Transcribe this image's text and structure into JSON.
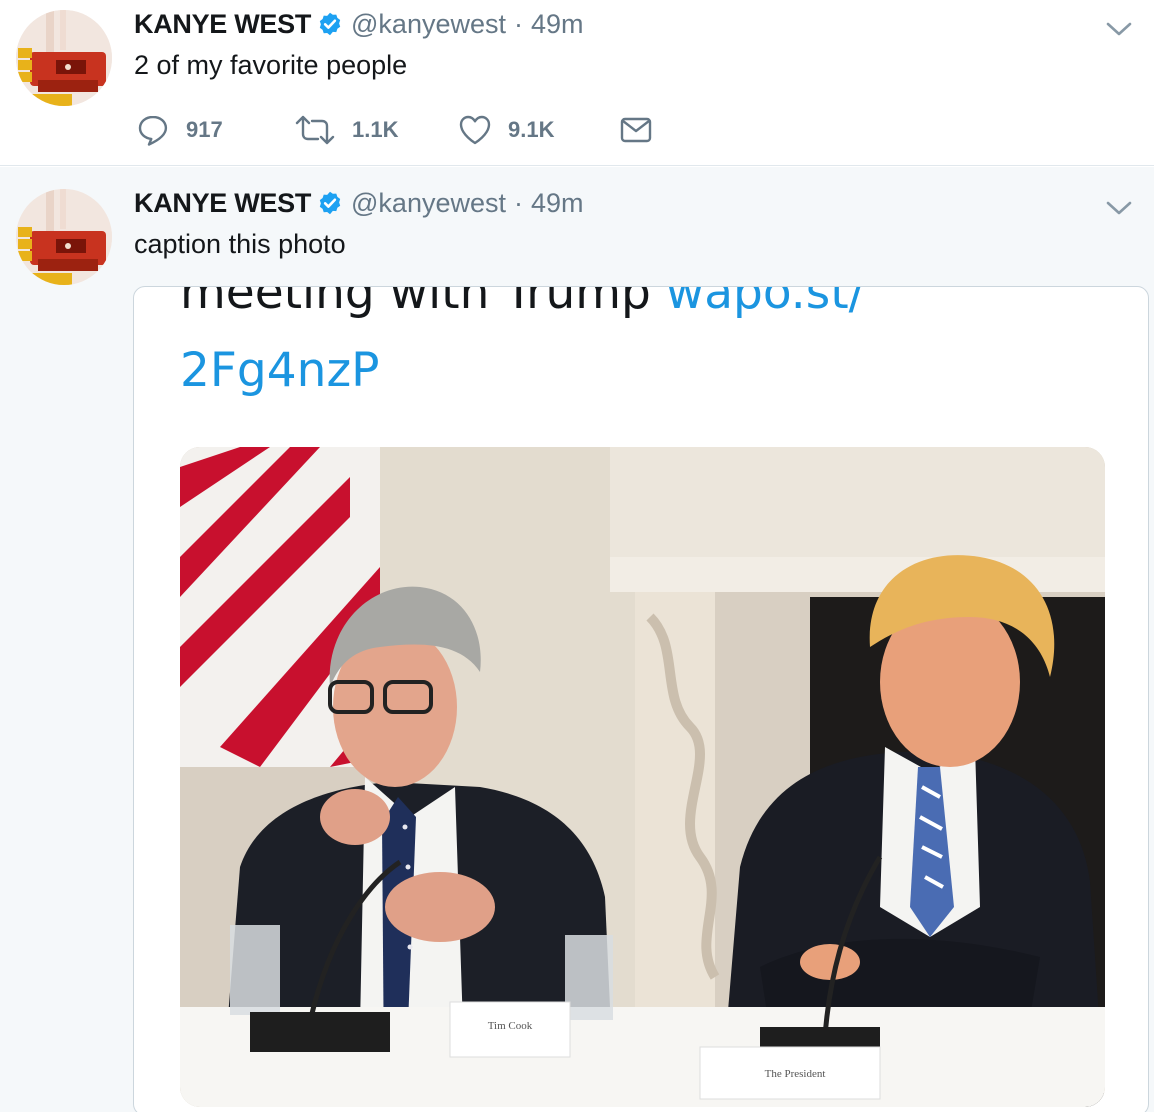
{
  "tweets": [
    {
      "author": {
        "name": "KANYE WEST",
        "handle": "@kanyewest"
      },
      "separator": "·",
      "time": "49m",
      "text": "2 of my favorite people",
      "counts": {
        "replies": "917",
        "retweets": "1.1K",
        "likes": "9.1K"
      }
    },
    {
      "author": {
        "name": "KANYE WEST",
        "handle": "@kanyewest"
      },
      "separator": "·",
      "time": "49m",
      "text": "caption this photo",
      "media": {
        "embedded_text_line1": "meeting with Trump ",
        "embedded_link_line1": "wapo.st/",
        "embedded_link_line2": "2Fg4nzP",
        "nameplate_left": "Tim Cook",
        "nameplate_right": "The President"
      }
    }
  ],
  "colors": {
    "verified_badge": "#1da1f2",
    "link": "#1b95e0",
    "muted_text": "#657786",
    "background_alt": "#f5f8fa"
  },
  "icons": [
    "verified-badge-icon",
    "chevron-down-icon",
    "reply-icon",
    "retweet-icon",
    "heart-icon",
    "envelope-icon"
  ]
}
